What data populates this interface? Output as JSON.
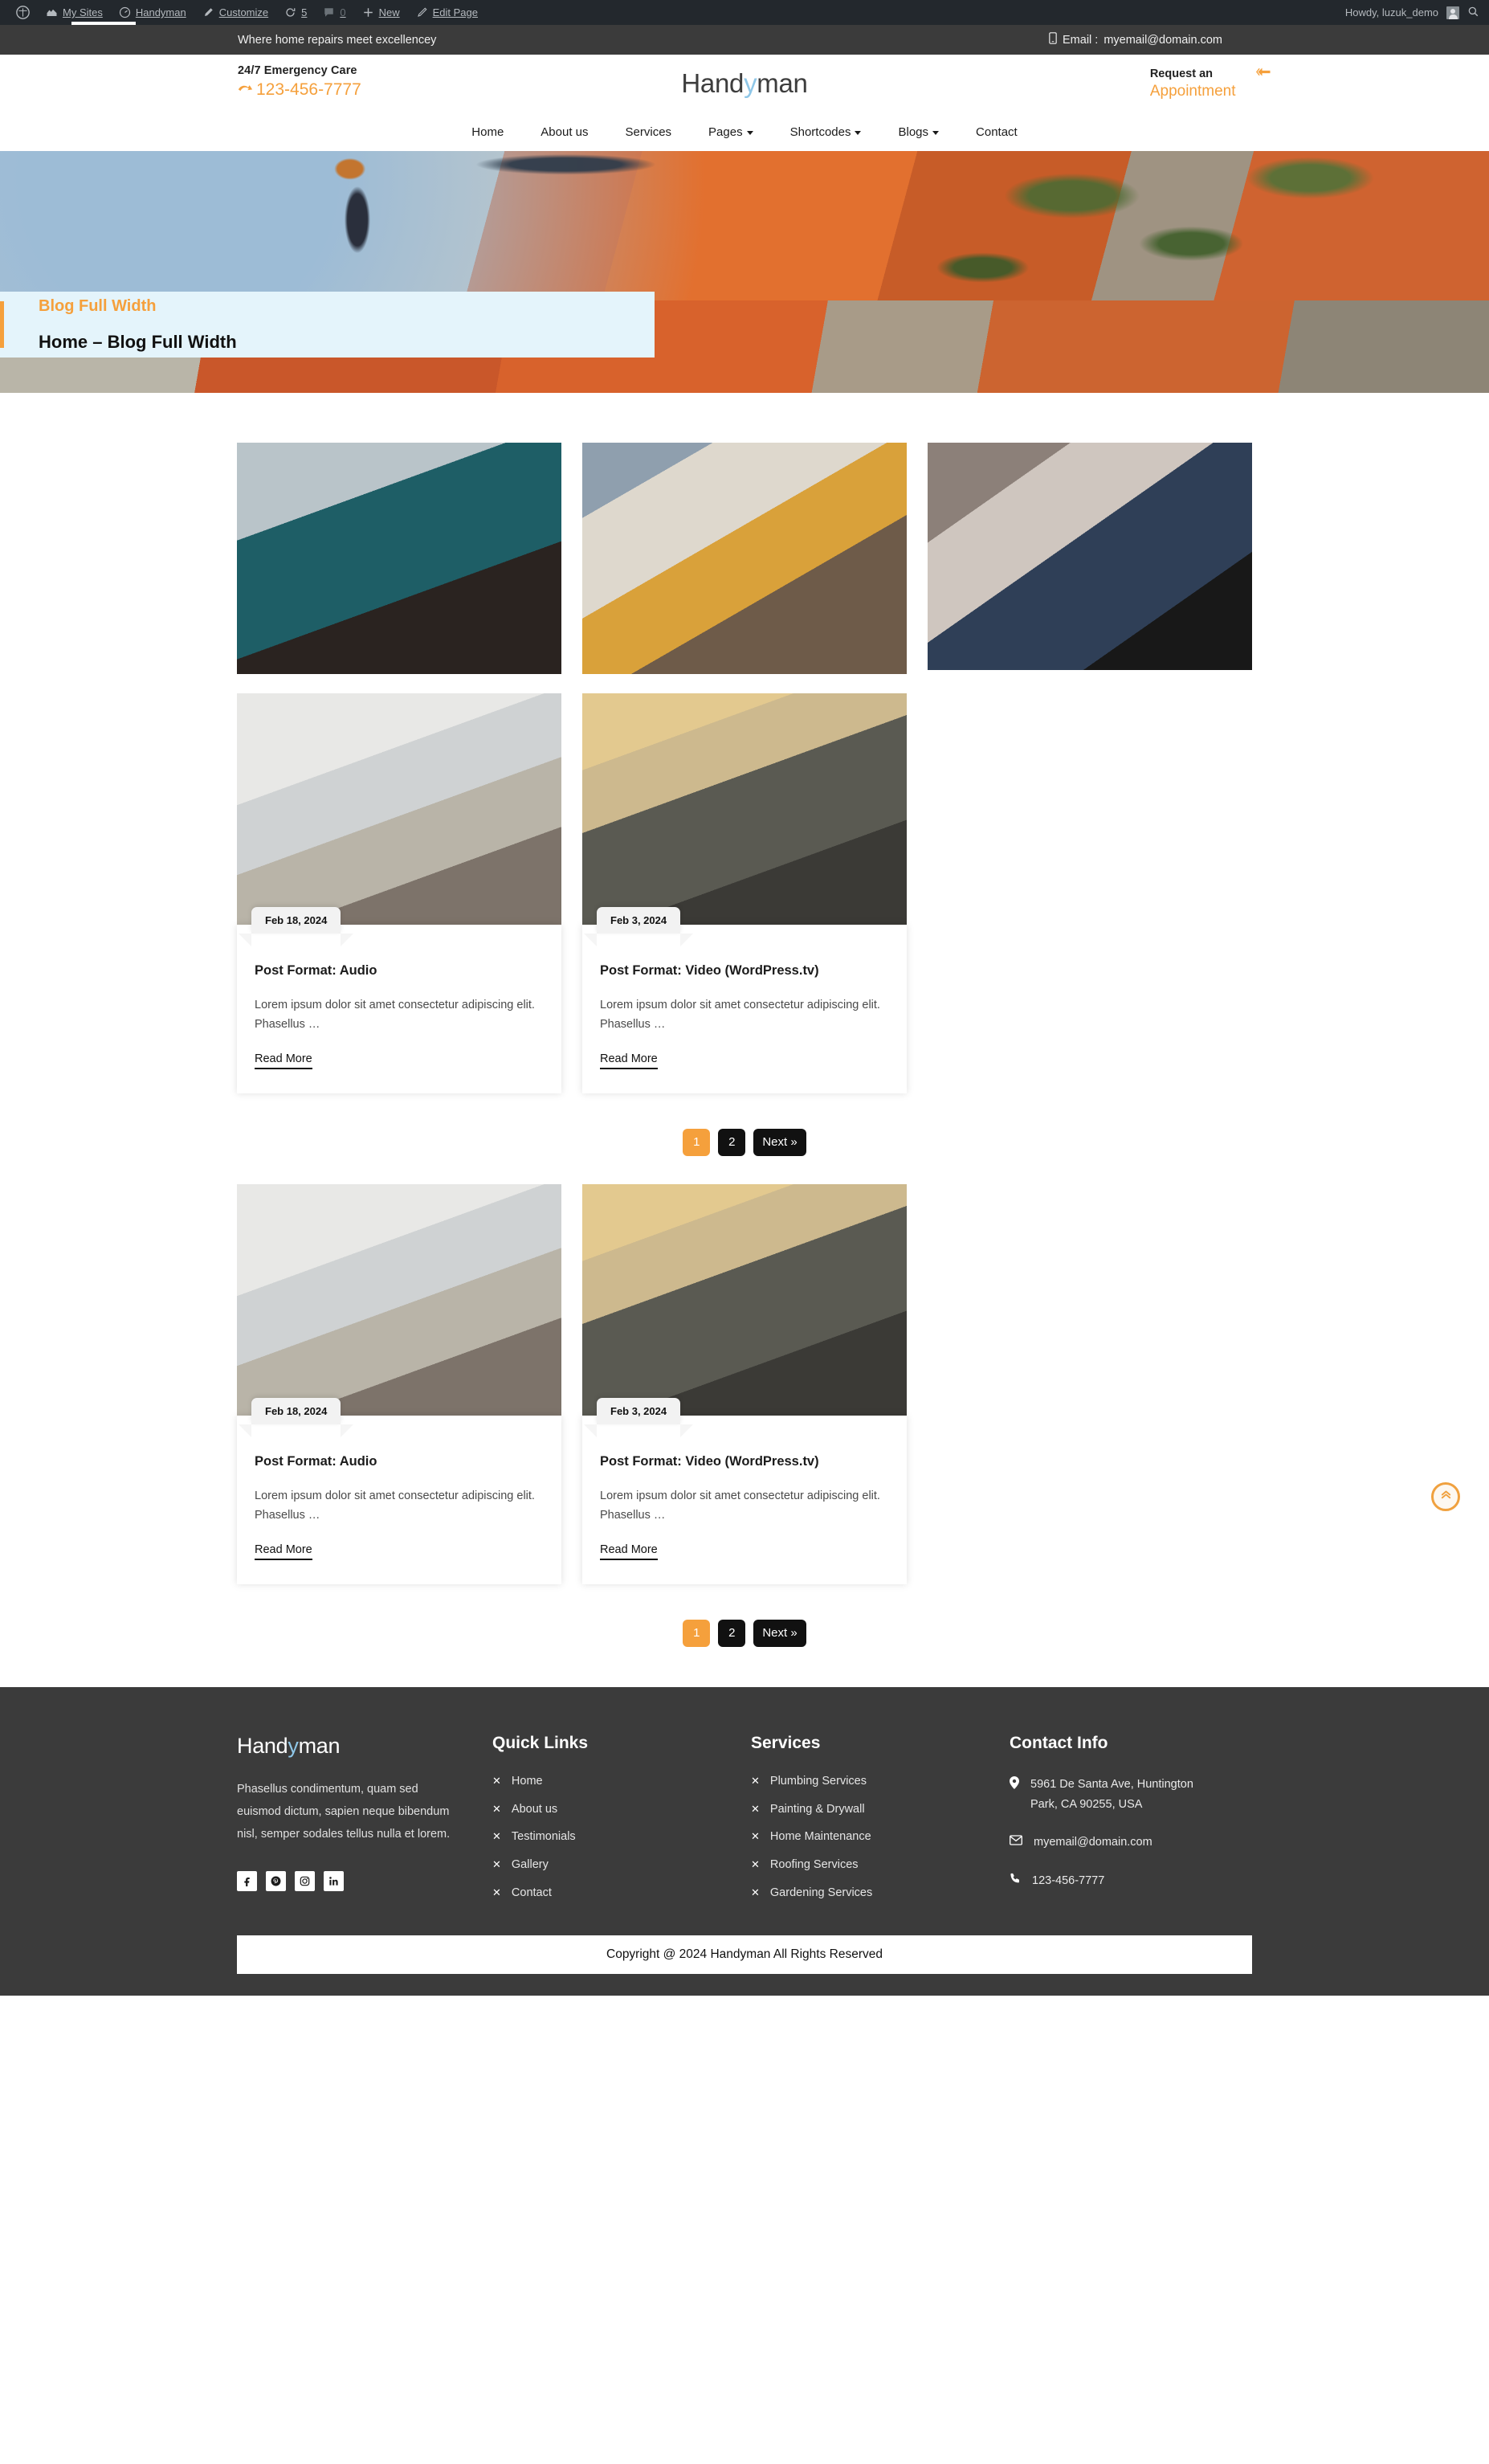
{
  "adminbar": {
    "items": [
      {
        "icon": "wordpress-logo-icon",
        "label": ""
      },
      {
        "icon": "my-sites-icon",
        "label": "My Sites"
      },
      {
        "icon": "dashboard-icon",
        "label": "Handyman"
      },
      {
        "icon": "pencil-icon",
        "label": "Customize"
      },
      {
        "icon": "updates-icon",
        "label": "5"
      },
      {
        "icon": "comment-icon",
        "label": "0"
      },
      {
        "icon": "plus-icon",
        "label": "New"
      },
      {
        "icon": "edit-icon",
        "label": "Edit Page"
      }
    ],
    "howdy": "Howdy, luzuk_demo"
  },
  "topbar": {
    "tagline": "Where home repairs meet excellencey",
    "email_label": "Email :",
    "email": "myemail@domain.com"
  },
  "header": {
    "emergency_label": "24/7 Emergency Care",
    "phone": "123-456-7777",
    "brand_pre": "Hand",
    "brand_y": "y",
    "brand_post": "man",
    "request_label": "Request an",
    "appointment_label": "Appointment"
  },
  "nav": {
    "items": [
      {
        "label": "Home",
        "has_caret": false
      },
      {
        "label": "About us",
        "has_caret": false
      },
      {
        "label": "Services",
        "has_caret": false
      },
      {
        "label": "Pages",
        "has_caret": true
      },
      {
        "label": "Shortcodes",
        "has_caret": true
      },
      {
        "label": "Blogs",
        "has_caret": true
      },
      {
        "label": "Contact",
        "has_caret": false
      }
    ]
  },
  "hero": {
    "breadcrumb_title": "Blog Full Width",
    "breadcrumb_path": "Home – Blog Full Width"
  },
  "blog": {
    "image_tiles": [
      {
        "name": "electronics-technician-photo"
      },
      {
        "name": "painter-straw-hat-photo"
      },
      {
        "name": "carpenter-kitchen-photo"
      }
    ],
    "posts": [
      {
        "date": "Feb 18, 2024",
        "title": "Post Format: Audio",
        "excerpt": "Lorem ipsum dolor sit amet consectetur adipiscing elit. Phasellus …",
        "read_more": "Read More",
        "image": "plumber-water-heater-photo"
      },
      {
        "date": "Feb 3, 2024",
        "title": "Post Format: Video (WordPress.tv)",
        "excerpt": "Lorem ipsum dolor sit amet consectetur adipiscing elit. Phasellus …",
        "read_more": "Read More",
        "image": "construction-worker-helmet-photo"
      }
    ],
    "pagination": [
      {
        "label": "1",
        "active": true
      },
      {
        "label": "2",
        "active": false
      },
      {
        "label": "Next »",
        "active": false
      }
    ]
  },
  "footer": {
    "brand_pre": "Hand",
    "brand_y": "y",
    "brand_post": "man",
    "about": "Phasellus condimentum, quam sed euismod dictum, sapien neque bibendum nisl, semper sodales tellus nulla et lorem.",
    "quick_links_title": "Quick Links",
    "quick_links": [
      "Home",
      "About us",
      "Testimonials",
      "Gallery",
      "Contact"
    ],
    "services_title": "Services",
    "services": [
      "Plumbing Services",
      "Painting & Drywall",
      "Home Maintenance",
      "Roofing Services",
      "Gardening Services"
    ],
    "contact_title": "Contact Info",
    "address": "5961 De Santa Ave, Huntington Park, CA 90255, USA",
    "email": "myemail@domain.com",
    "phone": "123-456-7777",
    "socials": [
      "facebook-icon",
      "pinterest-icon",
      "instagram-icon",
      "linkedin-icon"
    ],
    "copyright": "Copyright @ 2024 Handyman All Rights Reserved"
  },
  "colors": {
    "accent": "#f5a03c",
    "dark": "#3b3b3b",
    "adminbar": "#23282d",
    "breadcrumb_bg": "#e4f4fb",
    "logo_y": "#8fc7e8"
  }
}
